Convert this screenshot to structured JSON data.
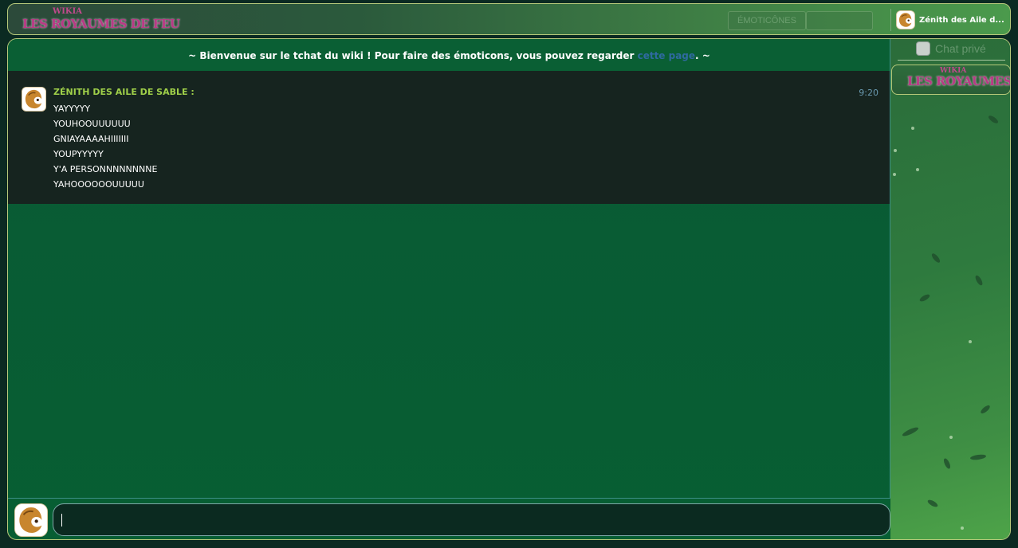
{
  "header": {
    "logo_wikia": "WIKIA",
    "logo_name": "LES ROYAUMES DE FEU",
    "button_1": "ÉMOTICÔNES",
    "button_2": "",
    "user_name": "Zénith des Aile d..."
  },
  "welcome": {
    "prefix": "~ Bienvenue sur le tchat du wiki ! Pour faire des émoticons, vous pouvez regarder ",
    "link": "cette page",
    "suffix": ". ~"
  },
  "message": {
    "user": "ZÉNITH DES AILE DE SABLE :",
    "time": "9:20",
    "lines": [
      "YAYYYYY",
      "YOUHOOUUUUUU",
      "GNIAYAAAAHIIIIIII",
      "YOUPYYYYY",
      "Y'A PERSONNNNNNNNE",
      "YAHOOOOOOUUUUU"
    ]
  },
  "sidebar": {
    "private_label": "Chat privé",
    "room_wikia": "WIKIA",
    "room_name": "LES ROYAUMES DE FEU"
  },
  "input": {
    "value": ""
  },
  "colors": {
    "accent_username": "#9fcf49",
    "link": "#2f6aa0",
    "chat_bg": "#075e33",
    "message_bg": "#16241f"
  }
}
